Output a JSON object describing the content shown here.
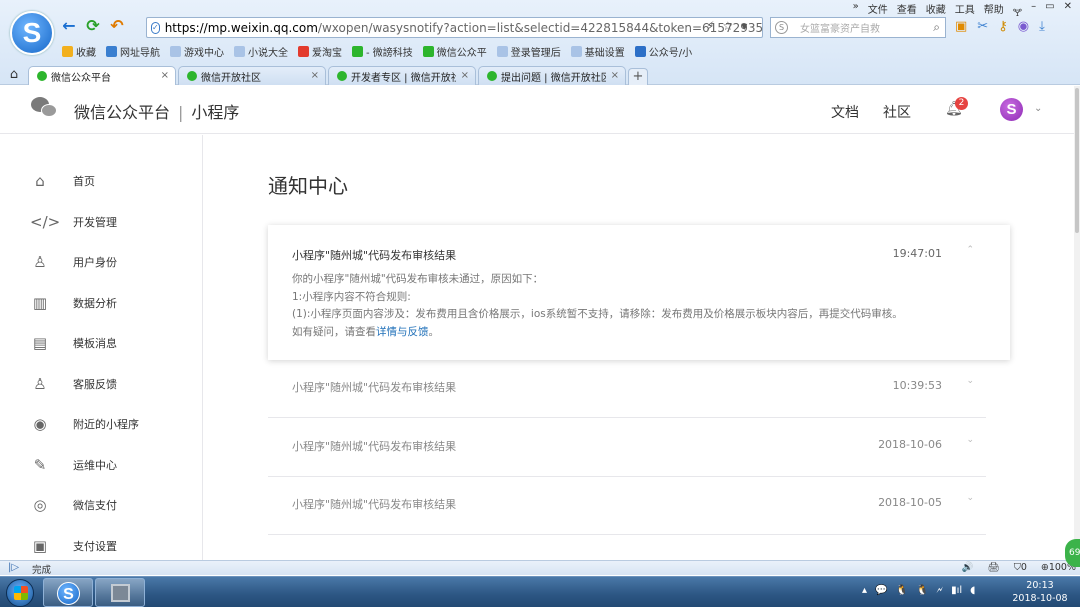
{
  "browser": {
    "menu": [
      "»",
      "文件",
      "查看",
      "收藏",
      "工具",
      "帮助",
      "🝖",
      "–",
      "▭",
      "✕"
    ],
    "address_host": "https://mp.weixin.qq.com",
    "address_rest": "/wxopen/wasysnotify?action=list&selectid=422815844&token=615729353&l",
    "search_placeholder": "女篮富豪资产自救",
    "bookmarks": [
      {
        "label": "收藏",
        "color": "#f2b01e"
      },
      {
        "label": "网址导航",
        "color": "#3a7fd0"
      },
      {
        "label": "游戏中心",
        "color": "#a9c3e6"
      },
      {
        "label": "小说大全",
        "color": "#a9c3e6"
      },
      {
        "label": "爱淘宝",
        "color": "#e33b2e"
      },
      {
        "label": "- 微謗科技",
        "color": "#2db52d"
      },
      {
        "label": "微信公众平",
        "color": "#2db52d"
      },
      {
        "label": "登录管理后",
        "color": "#a9c3e6"
      },
      {
        "label": "基础设置",
        "color": "#a9c3e6"
      },
      {
        "label": "公众号/小",
        "color": "#2c6fc7"
      }
    ],
    "tabs": [
      {
        "label": "微信公众平台",
        "active": true
      },
      {
        "label": "微信开放社区",
        "active": false
      },
      {
        "label": "开发者专区 | 微信开放社",
        "active": false
      },
      {
        "label": "提出问题 | 微信开放社区",
        "active": false
      }
    ],
    "tab_add": "+",
    "status_text": "完成",
    "status_right": [
      "🔊",
      "🖨",
      "⛉0",
      "⊕100%"
    ],
    "float_badge": "69"
  },
  "header": {
    "brand": "微信公众平台",
    "brand_sep": "|",
    "product": "小程序",
    "doc_link": "文档",
    "community_link": "社区",
    "notification_count": "2",
    "avatar_letter": "S"
  },
  "sidebar": {
    "items": [
      {
        "label": "首页",
        "icon": "⌂"
      },
      {
        "label": "开发管理",
        "icon": "</>"
      },
      {
        "label": "用户身份",
        "icon": "♙"
      },
      {
        "label": "数据分析",
        "icon": "▥"
      },
      {
        "label": "模板消息",
        "icon": "▤"
      },
      {
        "label": "客服反馈",
        "icon": "♙"
      },
      {
        "label": "附近的小程序",
        "icon": "◉"
      },
      {
        "label": "运维中心",
        "icon": "✎"
      },
      {
        "label": "微信支付",
        "icon": "◎"
      },
      {
        "label": "支付设置",
        "icon": "▣"
      }
    ]
  },
  "main": {
    "title": "通知中心",
    "open_notice": {
      "title": "小程序\"随州城\"代码发布审核结果",
      "time": "19:47:01",
      "lines": [
        "你的小程序\"随州城\"代码发布审核未通过，原因如下：",
        "1:小程序内容不符合规则:",
        "(1):小程序页面内容涉及：发布费用且含价格展示，ios系统暂不支持，请移除：发布费用及价格展示板块内容后，再提交代码审核。"
      ],
      "last_prefix": "如有疑问，请查看",
      "last_link": "详情与反馈",
      "last_suffix": "。"
    },
    "notices": [
      {
        "title": "小程序\"随州城\"代码发布审核结果",
        "time": "10:39:53"
      },
      {
        "title": "小程序\"随州城\"代码发布审核结果",
        "time": "2018-10-06"
      },
      {
        "title": "小程序\"随州城\"代码发布审核结果",
        "time": "2018-10-05"
      }
    ]
  },
  "taskbar": {
    "tray": [
      "▴",
      "💬",
      "🐧",
      "🐧",
      "🗲",
      "▮ıl",
      "◖"
    ],
    "time": "20:13",
    "date": "2018-10-08"
  }
}
